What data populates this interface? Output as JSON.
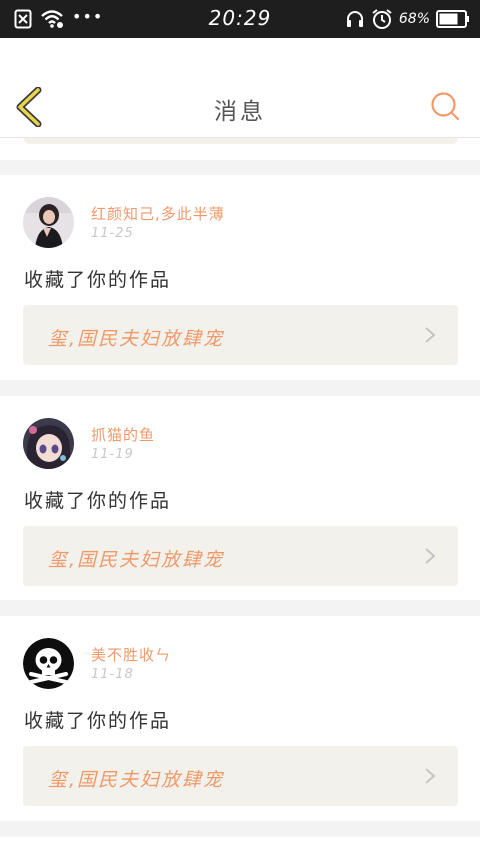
{
  "status_bar": {
    "time": "20:29",
    "battery": "68%",
    "icons": [
      "notification-x-icon",
      "wifi-icon",
      "more-dots-icon",
      "headphones-icon",
      "alarm-icon",
      "battery-icon"
    ],
    "dots": "•••"
  },
  "header": {
    "title": "消息",
    "back_icon": "chevron-left-icon",
    "search_icon": "search-icon"
  },
  "colors": {
    "accent": "#f09a6a",
    "back_icon": "#e8d64a",
    "date": "#c8c8c8",
    "work_bg": "#f2f1ec"
  },
  "messages": [
    {
      "username": "红颜知己,多此半薄",
      "date": "11-25",
      "action": "收藏了你的作品",
      "work_title": "玺,国民夫妇放肆宠",
      "avatar": "avatar-girl"
    },
    {
      "username": "抓猫的鱼",
      "date": "11-19",
      "action": "收藏了你的作品",
      "work_title": "玺,国民夫妇放肆宠",
      "avatar": "avatar-anime"
    },
    {
      "username": "美不胜收ㄣ",
      "date": "11-18",
      "action": "收藏了你的作品",
      "work_title": "玺,国民夫妇放肆宠",
      "avatar": "avatar-skull"
    }
  ]
}
